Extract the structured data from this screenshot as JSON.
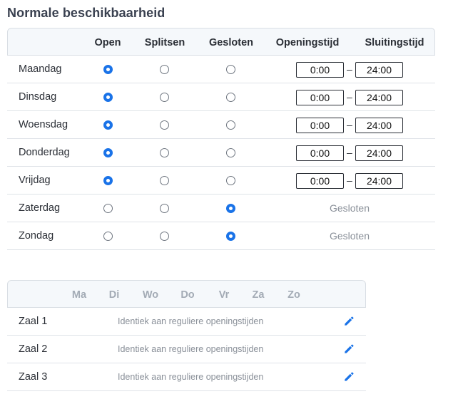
{
  "title": "Normale beschikbaarheid",
  "schedule": {
    "columns": [
      "Open",
      "Splitsen",
      "Gesloten",
      "Openingstijd",
      "Sluitingstijd"
    ],
    "closed_label": "Gesloten",
    "rows": [
      {
        "day": "Maandag",
        "state": "open",
        "open_time": "0:00",
        "close_time": "24:00"
      },
      {
        "day": "Dinsdag",
        "state": "open",
        "open_time": "0:00",
        "close_time": "24:00"
      },
      {
        "day": "Woensdag",
        "state": "open",
        "open_time": "0:00",
        "close_time": "24:00"
      },
      {
        "day": "Donderdag",
        "state": "open",
        "open_time": "0:00",
        "close_time": "24:00"
      },
      {
        "day": "Vrijdag",
        "state": "open",
        "open_time": "0:00",
        "close_time": "24:00"
      },
      {
        "day": "Zaterdag",
        "state": "closed",
        "open_time": "",
        "close_time": ""
      },
      {
        "day": "Zondag",
        "state": "closed",
        "open_time": "",
        "close_time": ""
      }
    ]
  },
  "rooms": {
    "days": [
      "Ma",
      "Di",
      "Wo",
      "Do",
      "Vr",
      "Za",
      "Zo"
    ],
    "rows": [
      {
        "name": "Zaal 1",
        "description": "Identiek aan reguliere openingstijden",
        "icon": "pencil-icon"
      },
      {
        "name": "Zaal 2",
        "description": "Identiek aan reguliere openingstijden",
        "icon": "pencil-icon"
      },
      {
        "name": "Zaal 3",
        "description": "Identiek aan reguliere openingstijden",
        "icon": "pencil-icon"
      }
    ]
  },
  "colors": {
    "accent": "#1a73e8",
    "header_bg": "#f5f8fb",
    "muted_text": "#8a9099"
  }
}
